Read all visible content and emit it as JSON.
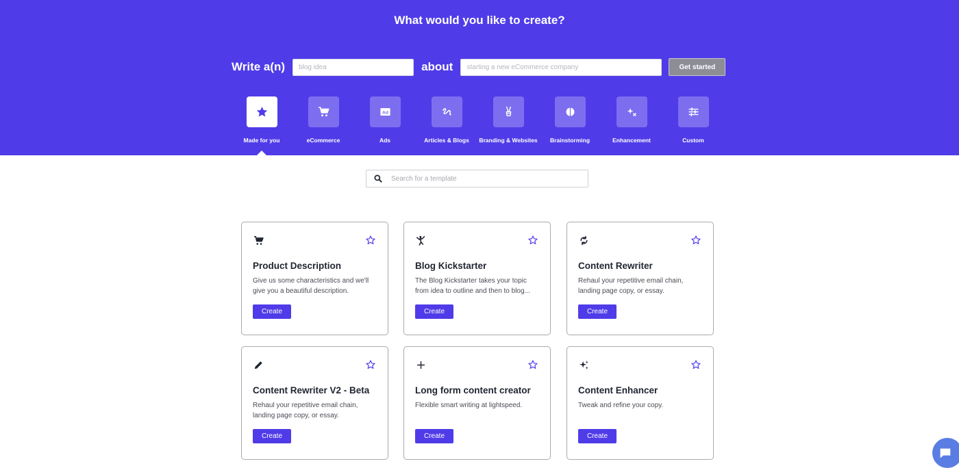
{
  "hero": {
    "title": "What would you like to create?",
    "write_label": "Write a(n)",
    "topic_placeholder": "blog idea",
    "about_label": "about",
    "about_placeholder": "starting a new eCommerce company",
    "get_started_label": "Get started"
  },
  "categories": [
    {
      "label": "Made for you",
      "icon": "star-icon",
      "active": true
    },
    {
      "label": "eCommerce",
      "icon": "cart-icon"
    },
    {
      "label": "Ads",
      "icon": "ad-icon"
    },
    {
      "label": "Articles & Blogs",
      "icon": "pen-squiggle-icon"
    },
    {
      "label": "Branding & Websites",
      "icon": "peace-hand-icon"
    },
    {
      "label": "Brainstorming",
      "icon": "brain-icon"
    },
    {
      "label": "Enhancement",
      "icon": "sparkle-icon"
    },
    {
      "label": "Custom",
      "icon": "sliders-icon"
    }
  ],
  "search": {
    "placeholder": "Search for a template"
  },
  "cards": [
    {
      "title": "Product Description",
      "description": "Give us some characteristics and we'll give you a beautiful description.",
      "button": "Create",
      "icon": "cart-icon"
    },
    {
      "title": "Blog Kickstarter",
      "description": "The Blog Kickstarter takes your topic from idea to outline and then to blog...",
      "button": "Create",
      "icon": "kick-icon"
    },
    {
      "title": "Content Rewriter",
      "description": "Rehaul your repetitive email chain, landing page copy, or essay.",
      "button": "Create",
      "icon": "refresh-icon"
    },
    {
      "title": "Content Rewriter V2 - Beta",
      "description": "Rehaul your repetitive email chain, landing page copy, or essay.",
      "button": "Create",
      "icon": "pencil-icon"
    },
    {
      "title": "Long form content creator",
      "description": "Flexible smart writing at lightspeed.",
      "button": "Create",
      "icon": "plus-icon"
    },
    {
      "title": "Content Enhancer",
      "description": "Tweak and refine your copy.",
      "button": "Create",
      "icon": "sparkle-icon"
    }
  ],
  "colors": {
    "accent": "#4f3ce8",
    "tile": "#7d6ef0",
    "chat": "#5a7de3"
  }
}
